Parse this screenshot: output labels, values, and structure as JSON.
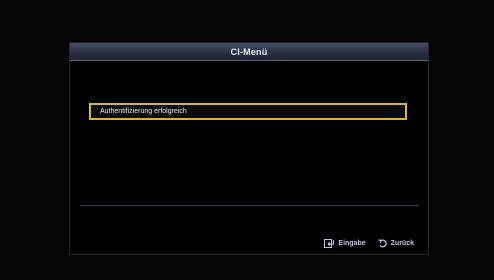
{
  "menu": {
    "title": "CI-Menü",
    "items": [
      {
        "label": "Authentifizierung erfolgreich",
        "selected": true
      }
    ]
  },
  "footer": {
    "enter_label": "Eingabe",
    "enter_icon": "enter-icon",
    "back_label": "Zurück",
    "back_icon": "return-arrow-icon"
  },
  "colors": {
    "selection_border": "#d9b722",
    "title_bar": "#2e3446",
    "divider": "#2a3f6a"
  }
}
